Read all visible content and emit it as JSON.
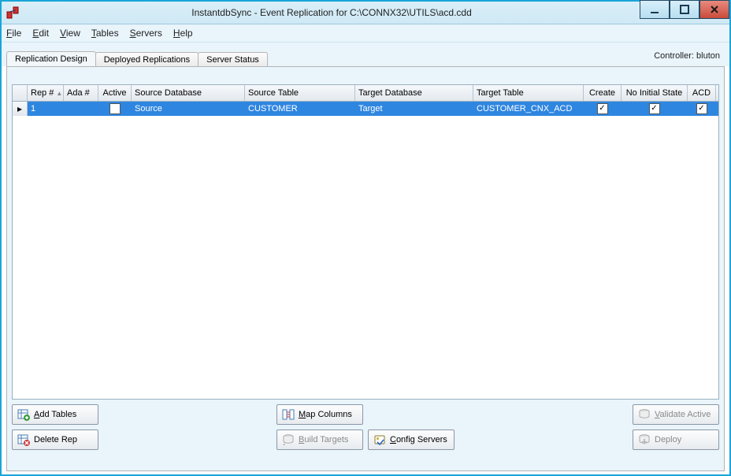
{
  "window": {
    "title": "InstantdbSync - Event Replication for C:\\CONNX32\\UTILS\\acd.cdd"
  },
  "menu": {
    "file": "File",
    "edit": "Edit",
    "view": "View",
    "tables": "Tables",
    "servers": "Servers",
    "help": "Help"
  },
  "tabs": {
    "design": "Replication Design",
    "deployed": "Deployed Replications",
    "status": "Server Status"
  },
  "controller_label": "Controller: bluton",
  "grid": {
    "headers": {
      "rep": "Rep #",
      "ada": "Ada #",
      "active": "Active",
      "srcdb": "Source Database",
      "srctbl": "Source Table",
      "tgtdb": "Target Database",
      "tgttbl": "Target Table",
      "create": "Create",
      "noinit": "No Initial State",
      "acd": "ACD"
    },
    "rows": [
      {
        "rep": "1",
        "ada": "",
        "active": false,
        "srcdb": "Source",
        "srctbl": "CUSTOMER",
        "tgtdb": "Target",
        "tgttbl": "CUSTOMER_CNX_ACD",
        "create": true,
        "noinit": true,
        "acd": true
      }
    ]
  },
  "buttons": {
    "add_tables": "Add Tables",
    "delete_rep": "Delete Rep",
    "map_columns": "Map Columns",
    "build_targets": "Build Targets",
    "config_servers": "Config Servers",
    "validate_active": "Validate Active",
    "deploy": "Deploy"
  }
}
